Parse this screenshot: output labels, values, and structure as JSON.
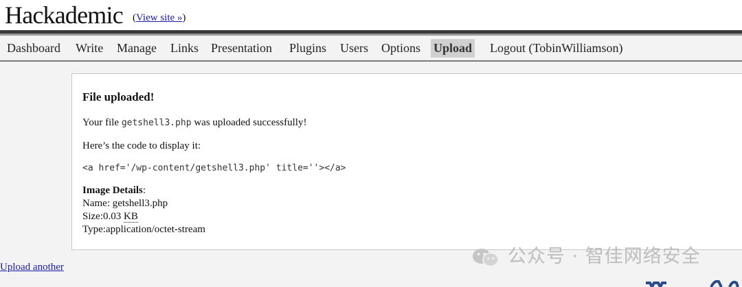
{
  "header": {
    "site_title": "Hackademic",
    "view_site_open": "(",
    "view_site_link": "View site »",
    "view_site_close": ")"
  },
  "menu": {
    "items": [
      {
        "label": "Dashboard"
      },
      {
        "label": "Write"
      },
      {
        "label": "Manage"
      },
      {
        "label": "Links"
      },
      {
        "label": "Presentation"
      },
      {
        "label": "Plugins"
      },
      {
        "label": "Users"
      },
      {
        "label": "Options"
      },
      {
        "label": "Upload",
        "current": true
      },
      {
        "label": "Logout (TobinWilliamson)"
      }
    ]
  },
  "upload": {
    "heading": "File uploaded!",
    "your_file_prefix": "Your file ",
    "file_name": "getshell3.php",
    "your_file_suffix": " was uploaded successfully!",
    "code_intro": "Here’s the code to display it:",
    "code": "<a href='/wp-content/getshell3.php' title=''></a>",
    "details_heading": "Image Details",
    "details_colon": ":",
    "name_label": "Name: ",
    "name_value": "getshell3.php",
    "size_label": "Size:",
    "size_value": "0.03 ",
    "size_unit": "KB",
    "type_label": "Type:",
    "type_value": "application/octet-stream"
  },
  "upload_another": "Upload another",
  "watermark": {
    "icon": "wechat-icon",
    "text": "公众号 · 智佳网络安全"
  },
  "colors": {
    "link": "#1a1aa6",
    "current_tab_bg": "#d0d0d0",
    "header_rule": "#3b3b3b"
  }
}
